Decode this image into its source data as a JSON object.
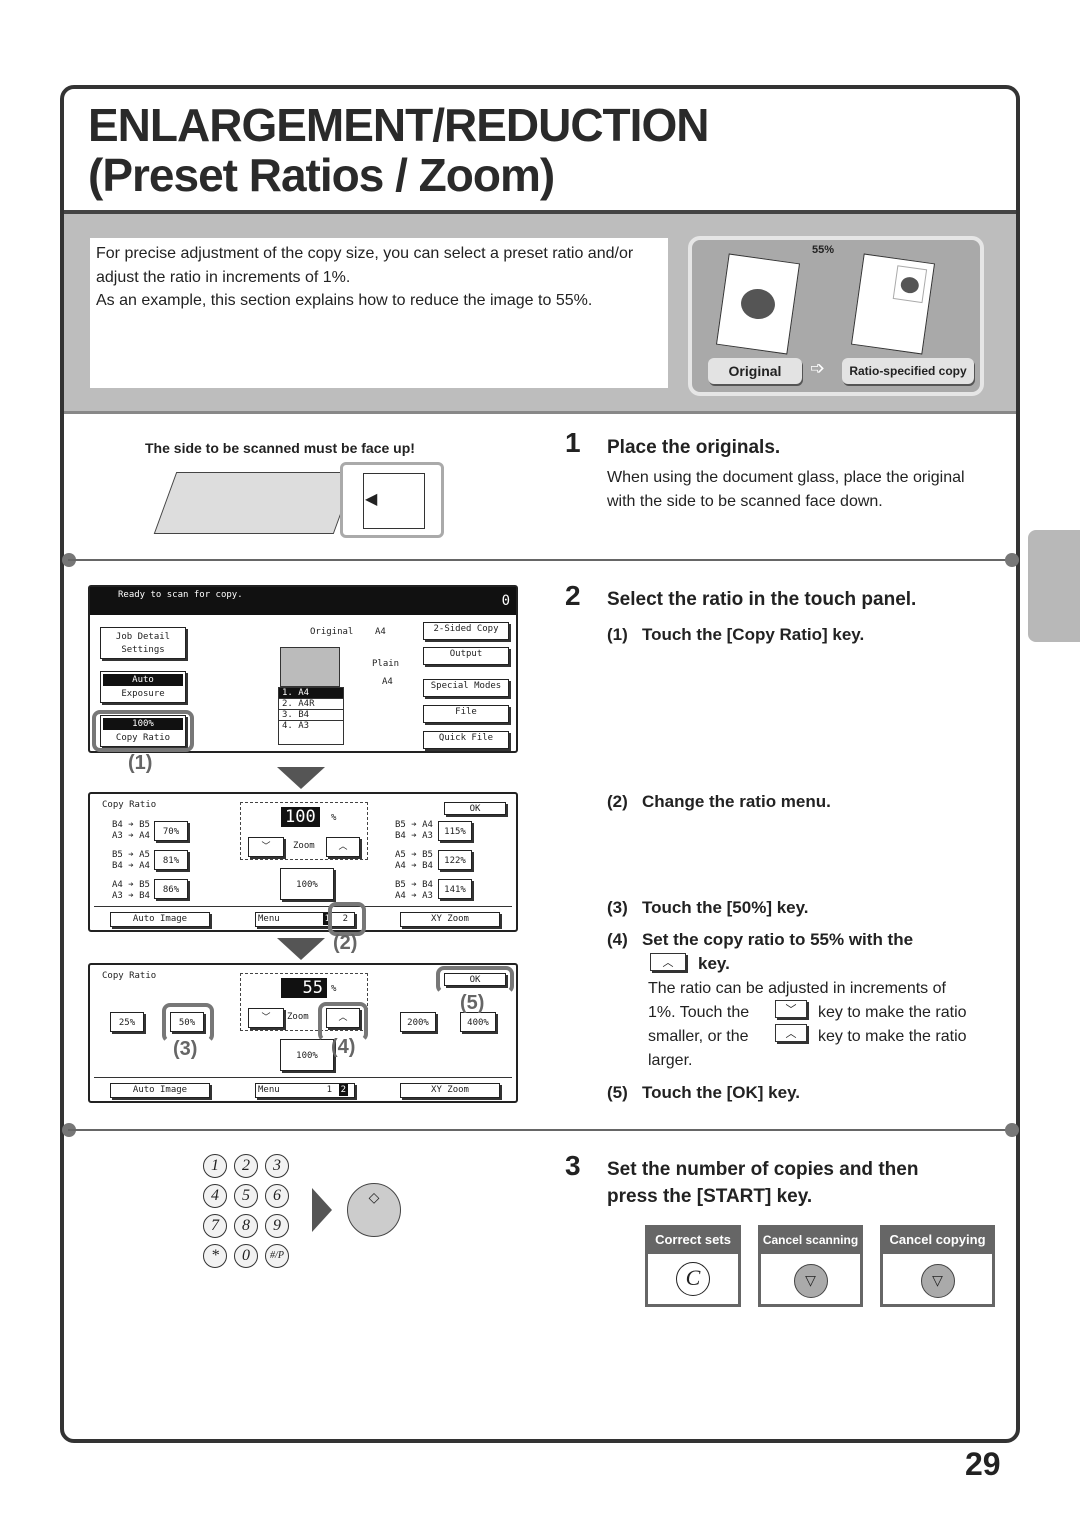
{
  "title": {
    "line1": "ENLARGEMENT/REDUCTION",
    "line2": "(Preset Ratios / Zoom)"
  },
  "intro": {
    "p1": "For precise adjustment of the copy size, you can select a preset ratio and/or adjust the ratio in increments of 1%.",
    "p2": "As an example, this section explains how to reduce the image to 55%."
  },
  "illustration": {
    "ratio": "55%",
    "original": "Original",
    "copy": "Ratio-specified copy"
  },
  "scan_note": "The side to be scanned must be face up!",
  "step1": {
    "num": "1",
    "heading": "Place the originals.",
    "text": "When using the document glass, place the original with the side to be scanned face down."
  },
  "step2": {
    "num": "2",
    "heading": "Select the ratio in the touch panel.",
    "sub1": {
      "num": "(1)",
      "text": "Touch the [Copy Ratio] key."
    },
    "sub2": {
      "num": "(2)",
      "text": "Change the ratio menu."
    },
    "sub3": {
      "num": "(3)",
      "text": "Touch the [50%] key."
    },
    "sub4": {
      "num": "(4)",
      "text_a": "Set the copy ratio to 55% with the",
      "text_b": "key.",
      "desc_a": "The ratio can be adjusted in increments of",
      "desc_b1": "1%. Touch the",
      "desc_b2": "key to make the ratio",
      "desc_c1": "smaller, or the",
      "desc_c2": "key to make the ratio",
      "desc_d": "larger."
    },
    "sub5": {
      "num": "(5)",
      "text": "Touch the [OK] key."
    }
  },
  "step3": {
    "num": "3",
    "heading_a": "Set the number of copies and then",
    "heading_b": "press the [START] key."
  },
  "panel_main": {
    "status": "Ready to scan for copy.",
    "count": "0",
    "job_detail": "Job Detail",
    "settings": "Settings",
    "auto": "Auto",
    "exposure": "Exposure",
    "ratio": "100%",
    "copy_ratio": "Copy Ratio",
    "original": "Original",
    "orig_size": "A4",
    "plain": "Plain",
    "paper_size": "A4",
    "trays": [
      {
        "n": "1.",
        "s": "A4"
      },
      {
        "n": "2.",
        "s": "A4R"
      },
      {
        "n": "3.",
        "s": "B4"
      },
      {
        "n": "4.",
        "s": "A3"
      }
    ],
    "two_sided": "2-Sided Copy",
    "output": "Output",
    "special": "Special Modes",
    "file": "File",
    "quick_file": "Quick File"
  },
  "panel_ratio1": {
    "label": "Copy Ratio",
    "value": "100",
    "pct": "%",
    "zoom": "Zoom",
    "ok": "OK",
    "reset": "100%",
    "left": [
      {
        "a": "B4 ➔ B5",
        "b": "A3 ➔ A4",
        "key": "70%"
      },
      {
        "a": "B5 ➔ A5",
        "b": "B4 ➔ A4",
        "key": "81%"
      },
      {
        "a": "A4 ➔ B5",
        "b": "A3 ➔ B4",
        "key": "86%"
      }
    ],
    "right": [
      {
        "a": "B5 ➔ A4",
        "b": "B4 ➔ A3",
        "key": "115%"
      },
      {
        "a": "A5 ➔ B5",
        "b": "A4 ➔ B4",
        "key": "122%"
      },
      {
        "a": "B5 ➔ B4",
        "b": "A4 ➔ A3",
        "key": "141%"
      }
    ],
    "auto_image": "Auto Image",
    "menu": "Menu",
    "page1": "1",
    "page2": "2",
    "xy_zoom": "XY Zoom"
  },
  "panel_ratio2": {
    "label": "Copy Ratio",
    "value": "55",
    "pct": "%",
    "zoom": "Zoom",
    "ok": "OK",
    "reset": "100%",
    "keys": [
      "25%",
      "50%",
      "200%",
      "400%"
    ],
    "auto_image": "Auto Image",
    "menu": "Menu",
    "page1": "1",
    "page2": "2",
    "xy_zoom": "XY Zoom"
  },
  "callouts": [
    "(1)",
    "(2)",
    "(3)",
    "(4)",
    "(5)"
  ],
  "keypad": [
    "1",
    "2",
    "3",
    "4",
    "5",
    "6",
    "7",
    "8",
    "9",
    "*",
    "0",
    "#/P"
  ],
  "keys": {
    "correct": "Correct sets",
    "correct_glyph": "C",
    "cancel_scan": "Cancel scanning",
    "cancel_copy": "Cancel copying"
  },
  "page_number": "29"
}
